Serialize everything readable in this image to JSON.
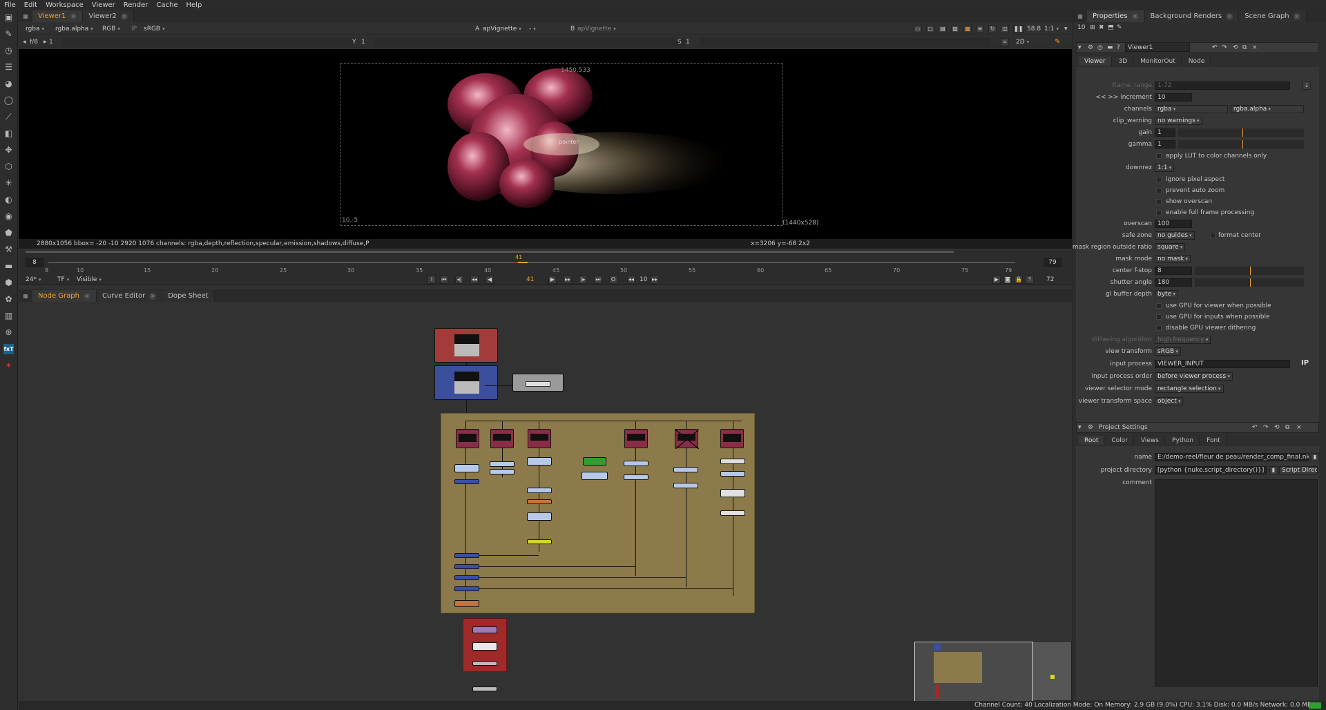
{
  "menu": [
    "File",
    "Edit",
    "Workspace",
    "Viewer",
    "Render",
    "Cache",
    "Help"
  ],
  "viewer_tabs": [
    {
      "label": "Viewer1"
    },
    {
      "label": "Viewer2"
    }
  ],
  "viewer_toolbar": {
    "channels": "rgba",
    "channel_alpha": "rgba.alpha",
    "colorspace_mode": "RGB",
    "ip": "IP",
    "lut": "sRGB",
    "input_a_label": "A",
    "input_a": "apVignette",
    "input_a_op": "-",
    "input_b_label": "B",
    "input_b": "apVignette",
    "zoom": "58.8",
    "ratio": "1:1"
  },
  "viewer_toolbar2": {
    "fstop": "f/8",
    "frame": "1",
    "y_label": "Y",
    "y_value": "1",
    "s_label": "S",
    "s_value": "1",
    "mode": "2D"
  },
  "viewer_image": {
    "top_right": "1450,533",
    "bottom_left": "10,-5",
    "bottom_right": "(1440x528)",
    "cursor_label": "pointer"
  },
  "viewer_info": {
    "left": "2880x1056  bbox= -20 -10 2920 1076 channels: rgba,depth,reflection,specular,emission,shadows,diffuse,P",
    "right": "x=3206 y=-68 2x2"
  },
  "timeline": {
    "start": "8",
    "end": "79",
    "current": "41",
    "ticks": [
      "8",
      "10",
      "15",
      "20",
      "25",
      "30",
      "35",
      "40",
      "45",
      "50",
      "55",
      "60",
      "65",
      "70",
      "75",
      "79"
    ],
    "fps": "24*",
    "tf": "TF",
    "visible": "Visible",
    "step": "10",
    "end_frame": "72",
    "current_field": "41"
  },
  "graph_tabs": [
    {
      "label": "Node Graph"
    },
    {
      "label": "Curve Editor"
    },
    {
      "label": "Dope Sheet"
    }
  ],
  "status_bar": "Channel Count: 40  Localization Mode: On  Memory: 2.9 GB (9.0%)  CPU: 3.1%  Disk: 0.0 MB/s  Network: 0.0 MB/s",
  "properties_tabs": [
    {
      "label": "Properties"
    },
    {
      "label": "Background Renders"
    },
    {
      "label": "Scene Graph"
    }
  ],
  "properties_count": "10",
  "viewer_panel": {
    "name": "Viewer1",
    "tabs": [
      "Viewer",
      "3D",
      "MonitorOut",
      "Node"
    ],
    "rows": [
      {
        "label": "frame_range",
        "value": "1-72",
        "type": "field",
        "disabled": true
      },
      {
        "label": "<< >> increment",
        "value": "10",
        "type": "field"
      },
      {
        "label": "channels",
        "value": "rgba",
        "value2": "rgba.alpha",
        "type": "combo2"
      },
      {
        "label": "clip_warning",
        "value": "no warnings",
        "type": "combo"
      },
      {
        "label": "gain",
        "value": "1",
        "type": "slider"
      },
      {
        "label": "gamma",
        "value": "1",
        "type": "slider"
      },
      {
        "label": "",
        "value": "apply LUT to color channels only",
        "type": "check"
      },
      {
        "label": "downrez",
        "value": "1:1",
        "type": "combo"
      },
      {
        "label": "",
        "value": "ignore pixel aspect",
        "type": "check"
      },
      {
        "label": "",
        "value": "prevent auto zoom",
        "type": "check"
      },
      {
        "label": "",
        "value": "show overscan",
        "type": "check"
      },
      {
        "label": "",
        "value": "enable full frame processing",
        "type": "check"
      },
      {
        "label": "overscan",
        "value": "100",
        "type": "field"
      },
      {
        "label": "safe zone",
        "value": "no guides",
        "value2": "format center",
        "type": "combocheck"
      },
      {
        "label": "mask region outside ratio",
        "value": "square",
        "type": "combo"
      },
      {
        "label": "mask mode",
        "value": "no mask",
        "type": "combo"
      },
      {
        "label": "center f-stop",
        "value": "8",
        "type": "slider"
      },
      {
        "label": "shutter angle",
        "value": "180",
        "type": "slider"
      },
      {
        "label": "gl buffer depth",
        "value": "byte",
        "type": "combo"
      },
      {
        "label": "",
        "value": "use GPU for viewer when possible",
        "type": "check"
      },
      {
        "label": "",
        "value": "use GPU for inputs when possible",
        "type": "check"
      },
      {
        "label": "",
        "value": "disable GPU viewer dithering",
        "type": "check"
      },
      {
        "label": "dithering algorithm",
        "value": "high frequency",
        "type": "combo",
        "disabled": true
      },
      {
        "label": "view transform",
        "value": "sRGB",
        "type": "combo"
      },
      {
        "label": "input process",
        "value": "VIEWER_INPUT",
        "type": "fieldip"
      },
      {
        "label": "input process order",
        "value": "before viewer process",
        "type": "combo"
      },
      {
        "label": "viewer selector mode",
        "value": "rectangle selection",
        "type": "combo"
      },
      {
        "label": "viewer transform space",
        "value": "object",
        "type": "combo"
      }
    ]
  },
  "project_panel": {
    "title": "Project Settings",
    "tabs": [
      "Root",
      "Color",
      "Views",
      "Python",
      "Font"
    ],
    "name_label": "name",
    "name_value": "E:/demo-reel/fleur de peau/render_comp_final.nk",
    "dir_label": "project directory",
    "dir_value": "[python {nuke.script_directory()}]",
    "dir_button": "Script Directory",
    "comment_label": "comment"
  },
  "colors": {
    "accent": "#f0a030",
    "backdrop": "#8c7a4a",
    "read_red": "#a23a3a",
    "merge_blue": "#3b4f9e",
    "cyan_node": "#b7c9e8",
    "green_node": "#2ea02e"
  }
}
